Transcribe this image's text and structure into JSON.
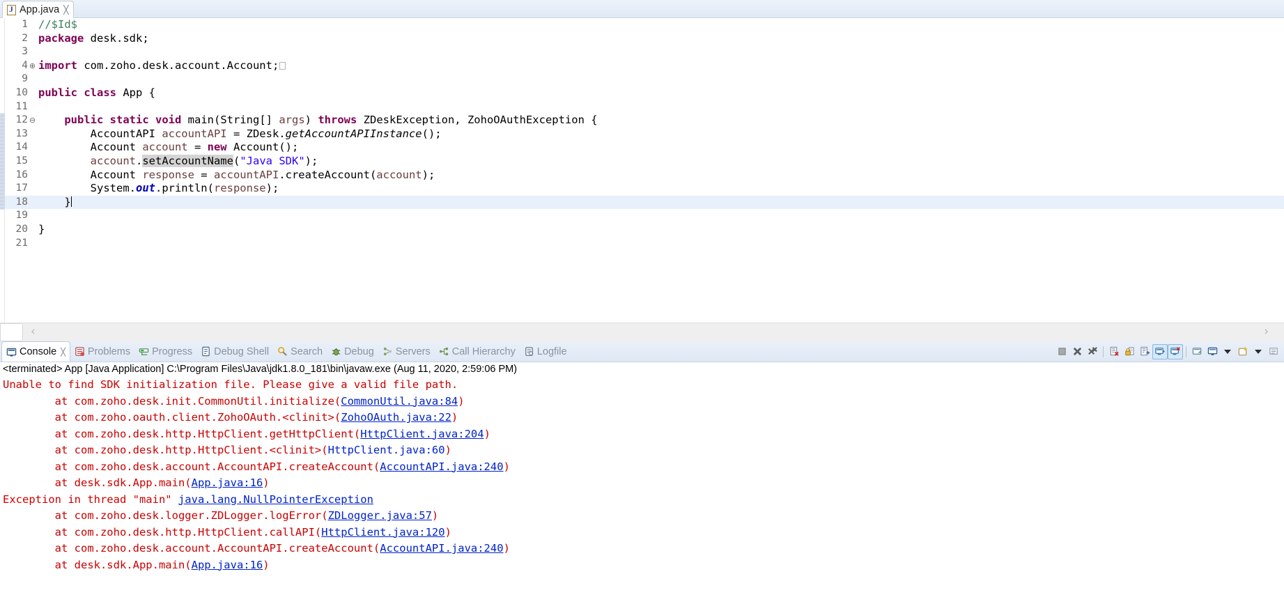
{
  "editor": {
    "tab": {
      "label": "App.java",
      "close_glyph": "╳",
      "icon": "java-file-icon"
    },
    "cursor_line": 18,
    "occurrence_highlight": "setAccountName",
    "lines": [
      {
        "num": "1",
        "fold": "",
        "tokens": [
          {
            "t": "//$Id$",
            "c": "cmt"
          }
        ]
      },
      {
        "num": "2",
        "fold": "",
        "tokens": [
          {
            "t": "package",
            "c": "kw"
          },
          {
            "t": " desk.sdk;",
            "c": "plain"
          }
        ]
      },
      {
        "num": "3",
        "fold": "",
        "tokens": []
      },
      {
        "num": "4",
        "fold": "⊕",
        "tokens": [
          {
            "t": "import",
            "c": "kw"
          },
          {
            "t": " com.zoho.desk.account.Account;",
            "c": "plain"
          },
          {
            "t": "",
            "c": "importbox"
          }
        ]
      },
      {
        "num": "9",
        "fold": "",
        "tokens": []
      },
      {
        "num": "10",
        "fold": "",
        "tokens": [
          {
            "t": "public",
            "c": "kw"
          },
          {
            "t": " ",
            "c": "plain"
          },
          {
            "t": "class",
            "c": "kw"
          },
          {
            "t": " App {",
            "c": "plain"
          }
        ]
      },
      {
        "num": "11",
        "fold": "",
        "tokens": []
      },
      {
        "num": "12",
        "fold": "⊖",
        "tokens": [
          {
            "t": "    ",
            "c": "plain"
          },
          {
            "t": "public",
            "c": "kw"
          },
          {
            "t": " ",
            "c": "plain"
          },
          {
            "t": "static",
            "c": "kw"
          },
          {
            "t": " ",
            "c": "plain"
          },
          {
            "t": "void",
            "c": "kw"
          },
          {
            "t": " main(String[] ",
            "c": "plain"
          },
          {
            "t": "args",
            "c": "param"
          },
          {
            "t": ") ",
            "c": "plain"
          },
          {
            "t": "throws",
            "c": "kw"
          },
          {
            "t": " ZDeskException, ZohoOAuthException {",
            "c": "plain"
          }
        ]
      },
      {
        "num": "13",
        "fold": "",
        "tokens": [
          {
            "t": "        AccountAPI ",
            "c": "plain"
          },
          {
            "t": "accountAPI",
            "c": "param"
          },
          {
            "t": " = ZDesk.",
            "c": "plain"
          },
          {
            "t": "getAccountAPIInstance",
            "c": "stat"
          },
          {
            "t": "();",
            "c": "plain"
          }
        ]
      },
      {
        "num": "14",
        "fold": "",
        "tokens": [
          {
            "t": "        Account ",
            "c": "plain"
          },
          {
            "t": "account",
            "c": "param"
          },
          {
            "t": " = ",
            "c": "plain"
          },
          {
            "t": "new",
            "c": "kw"
          },
          {
            "t": " Account();",
            "c": "plain"
          }
        ]
      },
      {
        "num": "15",
        "fold": "",
        "tokens": [
          {
            "t": "        ",
            "c": "plain"
          },
          {
            "t": "account",
            "c": "param"
          },
          {
            "t": ".",
            "c": "plain"
          },
          {
            "t": "setAccountName",
            "c": "occ"
          },
          {
            "t": "(",
            "c": "plain"
          },
          {
            "t": "\"Java SDK\"",
            "c": "str"
          },
          {
            "t": ");",
            "c": "plain"
          }
        ]
      },
      {
        "num": "16",
        "fold": "",
        "tokens": [
          {
            "t": "        Account ",
            "c": "plain"
          },
          {
            "t": "response",
            "c": "param"
          },
          {
            "t": " = ",
            "c": "plain"
          },
          {
            "t": "accountAPI",
            "c": "param"
          },
          {
            "t": ".createAccount(",
            "c": "plain"
          },
          {
            "t": "account",
            "c": "param"
          },
          {
            "t": ");",
            "c": "plain"
          }
        ]
      },
      {
        "num": "17",
        "fold": "",
        "tokens": [
          {
            "t": "        System.",
            "c": "plain"
          },
          {
            "t": "out",
            "c": "field"
          },
          {
            "t": ".println(",
            "c": "plain"
          },
          {
            "t": "response",
            "c": "param"
          },
          {
            "t": ");",
            "c": "plain"
          }
        ]
      },
      {
        "num": "18",
        "fold": "",
        "tokens": [
          {
            "t": "    }",
            "c": "plain"
          },
          {
            "t": "",
            "c": "caret"
          }
        ]
      },
      {
        "num": "19",
        "fold": "",
        "tokens": []
      },
      {
        "num": "20",
        "fold": "",
        "tokens": [
          {
            "t": "}",
            "c": "plain"
          }
        ]
      },
      {
        "num": "21",
        "fold": "",
        "tokens": []
      }
    ],
    "hscroll": {
      "left_arrow": "‹",
      "right_arrow": "›"
    }
  },
  "console": {
    "tabs": [
      {
        "label": "Console",
        "icon": "console-icon",
        "active": true,
        "closable": true
      },
      {
        "label": "Problems",
        "icon": "problems-icon",
        "active": false,
        "closable": false
      },
      {
        "label": "Progress",
        "icon": "progress-icon",
        "active": false,
        "closable": false
      },
      {
        "label": "Debug Shell",
        "icon": "debug-shell-icon",
        "active": false,
        "closable": false
      },
      {
        "label": "Search",
        "icon": "search-icon",
        "active": false,
        "closable": false
      },
      {
        "label": "Debug",
        "icon": "debug-icon",
        "active": false,
        "closable": false
      },
      {
        "label": "Servers",
        "icon": "servers-icon",
        "active": false,
        "closable": false
      },
      {
        "label": "Call Hierarchy",
        "icon": "call-hierarchy-icon",
        "active": false,
        "closable": false
      },
      {
        "label": "Logfile",
        "icon": "logfile-icon",
        "active": false,
        "closable": false
      }
    ],
    "tab_close_glyph": "╳",
    "toolbar": [
      {
        "name": "terminate-button",
        "kind": "stop",
        "pressed": false
      },
      {
        "name": "remove-launch-button",
        "kind": "x",
        "pressed": false
      },
      {
        "name": "remove-all-launches-button",
        "kind": "xx",
        "pressed": false
      },
      {
        "name": "separator-1",
        "kind": "sep",
        "pressed": false
      },
      {
        "name": "clear-console-button",
        "kind": "clear",
        "pressed": false
      },
      {
        "name": "scroll-lock-button",
        "kind": "lock",
        "pressed": false
      },
      {
        "name": "word-wrap-button",
        "kind": "wrap",
        "pressed": false
      },
      {
        "name": "show-console-on-output-button",
        "kind": "outconsole",
        "pressed": true
      },
      {
        "name": "show-console-on-error-button",
        "kind": "errconsole",
        "pressed": true
      },
      {
        "name": "separator-2",
        "kind": "sep",
        "pressed": false
      },
      {
        "name": "pin-console-button",
        "kind": "pin",
        "pressed": false
      },
      {
        "name": "display-selected-console-button",
        "kind": "display",
        "pressed": false
      },
      {
        "name": "display-selected-console-dropdown",
        "kind": "arrow",
        "pressed": false
      },
      {
        "name": "open-console-button",
        "kind": "newconsole",
        "pressed": false
      },
      {
        "name": "open-console-dropdown",
        "kind": "arrow",
        "pressed": false
      },
      {
        "name": "view-menu-button",
        "kind": "viewmenu",
        "pressed": false
      }
    ],
    "terminated_line": "<terminated> App [Java Application] C:\\Program Files\\Java\\jdk1.8.0_181\\bin\\javaw.exe (Aug 11, 2020, 2:59:06 PM)",
    "output": [
      {
        "indent": 0,
        "segments": [
          {
            "t": "Unable to find SDK initialization file. Please give a valid file path.",
            "k": "red"
          }
        ]
      },
      {
        "indent": 1,
        "segments": [
          {
            "t": "at com.zoho.desk.init.CommonUtil.initialize(",
            "k": "red"
          },
          {
            "t": "CommonUtil.java:84",
            "k": "link"
          },
          {
            "t": ")",
            "k": "red"
          }
        ]
      },
      {
        "indent": 1,
        "segments": [
          {
            "t": "at com.zoho.oauth.client.ZohoOAuth.<clinit>(",
            "k": "red"
          },
          {
            "t": "ZohoOAuth.java:22",
            "k": "link"
          },
          {
            "t": ")",
            "k": "red"
          }
        ]
      },
      {
        "indent": 1,
        "segments": [
          {
            "t": "at com.zoho.desk.http.HttpClient.getHttpClient(",
            "k": "red"
          },
          {
            "t": "HttpClient.java:204",
            "k": "link"
          },
          {
            "t": ")",
            "k": "red"
          }
        ]
      },
      {
        "indent": 1,
        "segments": [
          {
            "t": "at com.zoho.desk.http.HttpClient.<clinit>(",
            "k": "red"
          },
          {
            "t": "HttpClient.java:60",
            "k": "link-plain"
          },
          {
            "t": ")",
            "k": "red"
          }
        ]
      },
      {
        "indent": 1,
        "segments": [
          {
            "t": "at com.zoho.desk.account.AccountAPI.createAccount(",
            "k": "red"
          },
          {
            "t": "AccountAPI.java:240",
            "k": "link"
          },
          {
            "t": ")",
            "k": "red"
          }
        ]
      },
      {
        "indent": 1,
        "segments": [
          {
            "t": "at desk.sdk.App.main(",
            "k": "red"
          },
          {
            "t": "App.java:16",
            "k": "link"
          },
          {
            "t": ")",
            "k": "red"
          }
        ]
      },
      {
        "indent": 0,
        "segments": [
          {
            "t": "Exception in thread \"main\" ",
            "k": "red"
          },
          {
            "t": "java.lang.NullPointerException",
            "k": "link"
          }
        ]
      },
      {
        "indent": 1,
        "segments": [
          {
            "t": "at com.zoho.desk.logger.ZDLogger.logError(",
            "k": "red"
          },
          {
            "t": "ZDLogger.java:57",
            "k": "link"
          },
          {
            "t": ")",
            "k": "red"
          }
        ]
      },
      {
        "indent": 1,
        "segments": [
          {
            "t": "at com.zoho.desk.http.HttpClient.callAPI(",
            "k": "red"
          },
          {
            "t": "HttpClient.java:120",
            "k": "link"
          },
          {
            "t": ")",
            "k": "red"
          }
        ]
      },
      {
        "indent": 1,
        "segments": [
          {
            "t": "at com.zoho.desk.account.AccountAPI.createAccount(",
            "k": "red"
          },
          {
            "t": "AccountAPI.java:240",
            "k": "link"
          },
          {
            "t": ")",
            "k": "red"
          }
        ]
      },
      {
        "indent": 1,
        "segments": [
          {
            "t": "at desk.sdk.App.main(",
            "k": "red"
          },
          {
            "t": "App.java:16",
            "k": "link"
          },
          {
            "t": ")",
            "k": "red"
          }
        ]
      }
    ]
  },
  "colors": {
    "error_red": "#cc0000",
    "link_blue": "#0022cc",
    "keyword_purple": "#7f0055",
    "string_blue": "#2a00ff",
    "comment_green": "#3f7f5f",
    "param_brown": "#6a3e3e",
    "current_line": "#e8f0fb",
    "occurrence_gray": "#d4d4d4",
    "tab_gradient_top": "#eef3fa",
    "tab_gradient_bottom": "#dfe9f5"
  }
}
